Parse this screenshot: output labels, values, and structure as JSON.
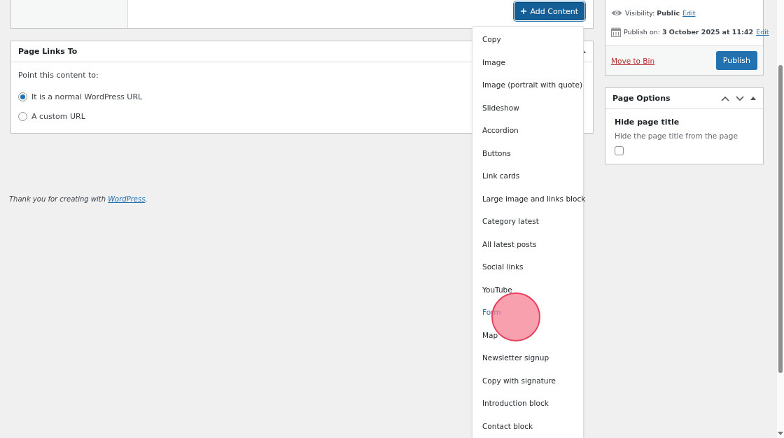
{
  "editor": {
    "add_content_button": "Add Content"
  },
  "content_menu": {
    "items": [
      {
        "label": "Copy",
        "hovered": false
      },
      {
        "label": "Image",
        "hovered": false
      },
      {
        "label": "Image (portrait with quote)",
        "hovered": false
      },
      {
        "label": "Slideshow",
        "hovered": false
      },
      {
        "label": "Accordion",
        "hovered": false
      },
      {
        "label": "Buttons",
        "hovered": false
      },
      {
        "label": "Link cards",
        "hovered": false
      },
      {
        "label": "Large image and links block",
        "hovered": false
      },
      {
        "label": "Category latest",
        "hovered": false
      },
      {
        "label": "All latest posts",
        "hovered": false
      },
      {
        "label": "Social links",
        "hovered": false
      },
      {
        "label": "YouTube",
        "hovered": false
      },
      {
        "label": "Form",
        "hovered": true
      },
      {
        "label": "Map",
        "hovered": false
      },
      {
        "label": "Newsletter signup",
        "hovered": false
      },
      {
        "label": "Copy with signature",
        "hovered": false
      },
      {
        "label": "Introduction block",
        "hovered": false
      },
      {
        "label": "Contact block",
        "hovered": false
      }
    ]
  },
  "page_links_to": {
    "title": "Page Links To",
    "prompt": "Point this content to:",
    "options": [
      {
        "label": "It is a normal WordPress URL",
        "selected": true
      },
      {
        "label": "A custom URL",
        "selected": false
      }
    ]
  },
  "footer": {
    "text": "Thank you for creating with",
    "link": "WordPress",
    "end": "."
  },
  "publish": {
    "visibility_label": "Visibility:",
    "visibility_value": "Public",
    "visibility_edit": "Edit",
    "date_label": "Publish on:",
    "date_value": "3 October 2025 at 11:42",
    "date_edit": "Edit",
    "trash_link": "Move to Bin",
    "publish_button": "Publish"
  },
  "page_options": {
    "title": "Page Options",
    "field_label": "Hide page title",
    "description": "Hide the page title from the page",
    "checked": false
  }
}
